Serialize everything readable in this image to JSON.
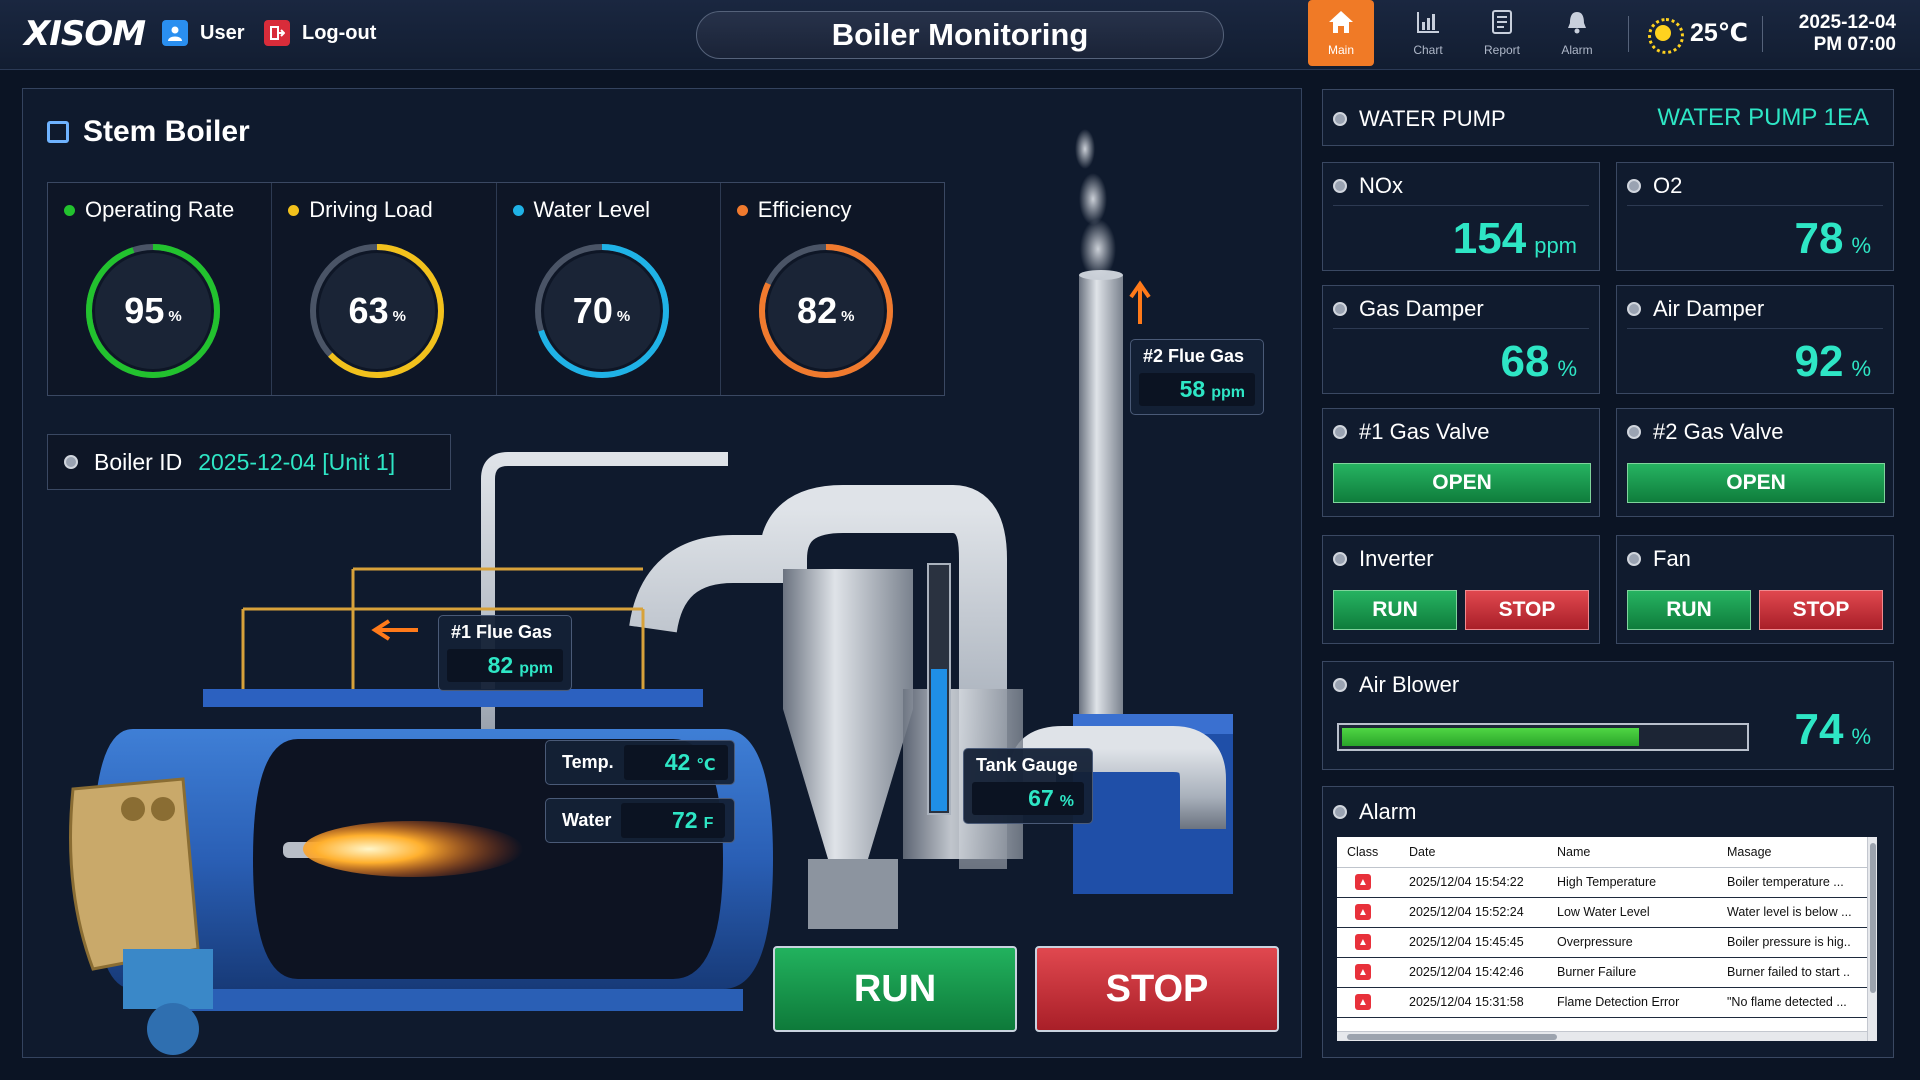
{
  "header": {
    "logo": "XISOM",
    "user_label": "User",
    "logout_label": "Log-out",
    "title": "Boiler Monitoring",
    "nav": [
      {
        "label": "Main",
        "icon": "home-icon"
      },
      {
        "label": "Chart",
        "icon": "chart-icon"
      },
      {
        "label": "Report",
        "icon": "report-icon"
      },
      {
        "label": "Alarm",
        "icon": "bell-icon"
      }
    ],
    "temperature": "25℃",
    "date": "2025-12-04",
    "time": "PM 07:00"
  },
  "main": {
    "title": "Stem Boiler",
    "gauges": [
      {
        "label": "Operating Rate",
        "value": "95",
        "unit": "%",
        "color": "#22c22e",
        "fraction": 0.95
      },
      {
        "label": "Driving Load",
        "value": "63",
        "unit": "%",
        "color": "#f2c11c",
        "fraction": 0.63
      },
      {
        "label": "Water Level",
        "value": "70",
        "unit": "%",
        "color": "#1fb2e6",
        "fraction": 0.7
      },
      {
        "label": "Efficiency",
        "value": "82",
        "unit": "%",
        "color": "#f07a2e",
        "fraction": 0.82
      }
    ],
    "boiler_id_label": "Boiler ID",
    "boiler_id_value": "2025-12-04 [Unit 1]",
    "flue1": {
      "label": "#1 Flue Gas",
      "value": "82",
      "unit": "ppm"
    },
    "flue2": {
      "label": "#2 Flue Gas",
      "value": "58",
      "unit": "ppm"
    },
    "temp": {
      "label": "Temp.",
      "value": "42",
      "unit": "℃"
    },
    "water": {
      "label": "Water",
      "value": "72",
      "unit": "F"
    },
    "tank": {
      "label": "Tank Gauge",
      "value": "67",
      "unit": "%",
      "level": 0.67
    },
    "run_label": "RUN",
    "stop_label": "STOP"
  },
  "right": {
    "pump": {
      "label": "WATER PUMP",
      "value": "WATER PUMP 1EA"
    },
    "nox": {
      "label": "NOx",
      "value": "154",
      "unit": "ppm"
    },
    "o2": {
      "label": "O2",
      "value": "78",
      "unit": "%"
    },
    "gas_damper": {
      "label": "Gas Damper",
      "value": "68",
      "unit": "%"
    },
    "air_damper": {
      "label": "Air Damper",
      "value": "92",
      "unit": "%"
    },
    "valve1": {
      "label": "#1 Gas Valve",
      "state": "OPEN"
    },
    "valve2": {
      "label": "#2 Gas Valve",
      "state": "OPEN"
    },
    "inverter": {
      "label": "Inverter",
      "run": "RUN",
      "stop": "STOP"
    },
    "fan": {
      "label": "Fan",
      "run": "RUN",
      "stop": "STOP"
    },
    "blower": {
      "label": "Air Blower",
      "value": "74",
      "unit": "%",
      "level": 0.74
    },
    "alarm": {
      "label": "Alarm",
      "columns": [
        "Class",
        "Date",
        "Name",
        "Masage"
      ],
      "rows": [
        {
          "date": "2025/12/04 15:54:22",
          "name": "High Temperature",
          "message": "Boiler temperature ..."
        },
        {
          "date": "2025/12/04 15:52:24",
          "name": "Low Water Level",
          "message": "Water level is below ..."
        },
        {
          "date": "2025/12/04 15:45:45",
          "name": "Overpressure",
          "message": "Boiler pressure is hig.."
        },
        {
          "date": "2025/12/04 15:42:46",
          "name": "Burner Failure",
          "message": "Burner failed to start .."
        },
        {
          "date": "2025/12/04 15:31:58",
          "name": "Flame Detection Error",
          "message": "\"No flame detected ..."
        }
      ]
    }
  }
}
